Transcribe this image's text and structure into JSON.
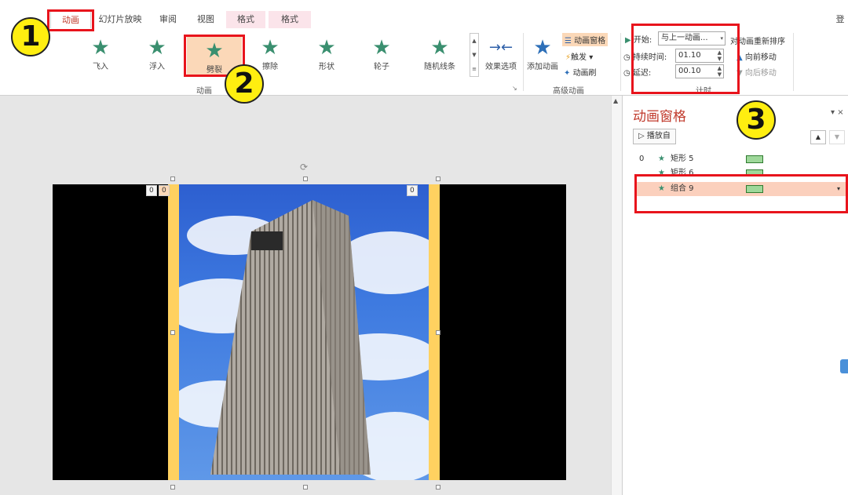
{
  "tabs": [
    {
      "label": "动画",
      "active": true
    },
    {
      "label": "幻灯片放映"
    },
    {
      "label": "审阅"
    },
    {
      "label": "视图"
    },
    {
      "label": "格式",
      "contextual": true
    },
    {
      "label": "格式",
      "contextual": true
    }
  ],
  "top_right_char": "登",
  "gallery": [
    "飞入",
    "浮入",
    "劈裂",
    "擦除",
    "形状",
    "轮子",
    "随机线条"
  ],
  "effect_options": "效果选项",
  "group_animation": "动画",
  "add_animation": "添加动画",
  "advanced": {
    "pane_btn": "动画窗格",
    "trigger": "触发",
    "painter": "动画刷",
    "group_label": "高级动画"
  },
  "timing": {
    "start_label": "开始:",
    "start_value": "与上一动画...",
    "duration_label": "持续时间:",
    "duration_value": "01.10",
    "delay_label": "延迟:",
    "delay_value": "00.10",
    "reorder": "对动画重新排序",
    "move_earlier": "向前移动",
    "move_later": "向后移动",
    "group_label": "计时"
  },
  "slide_tags": [
    "0",
    "0",
    "0"
  ],
  "pane": {
    "title": "动画窗格",
    "play_from": "播放自",
    "items": [
      {
        "index": "0",
        "name": "矩形 5"
      },
      {
        "index": "",
        "name": "矩形 6"
      },
      {
        "index": "",
        "name": "组合 9"
      }
    ]
  },
  "badges": [
    "1",
    "2",
    "3"
  ],
  "colors": {
    "accent": "#c0392b",
    "highlight": "#e8141c",
    "badge": "#ffee10",
    "effect_star": "#3a8f6f"
  }
}
